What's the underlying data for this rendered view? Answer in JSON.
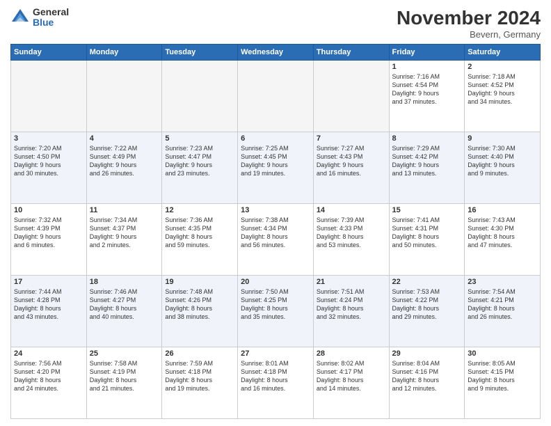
{
  "logo": {
    "general": "General",
    "blue": "Blue"
  },
  "header": {
    "month": "November 2024",
    "location": "Bevern, Germany"
  },
  "weekdays": [
    "Sunday",
    "Monday",
    "Tuesday",
    "Wednesday",
    "Thursday",
    "Friday",
    "Saturday"
  ],
  "weeks": [
    [
      {
        "day": "",
        "info": ""
      },
      {
        "day": "",
        "info": ""
      },
      {
        "day": "",
        "info": ""
      },
      {
        "day": "",
        "info": ""
      },
      {
        "day": "",
        "info": ""
      },
      {
        "day": "1",
        "info": "Sunrise: 7:16 AM\nSunset: 4:54 PM\nDaylight: 9 hours\nand 37 minutes."
      },
      {
        "day": "2",
        "info": "Sunrise: 7:18 AM\nSunset: 4:52 PM\nDaylight: 9 hours\nand 34 minutes."
      }
    ],
    [
      {
        "day": "3",
        "info": "Sunrise: 7:20 AM\nSunset: 4:50 PM\nDaylight: 9 hours\nand 30 minutes."
      },
      {
        "day": "4",
        "info": "Sunrise: 7:22 AM\nSunset: 4:49 PM\nDaylight: 9 hours\nand 26 minutes."
      },
      {
        "day": "5",
        "info": "Sunrise: 7:23 AM\nSunset: 4:47 PM\nDaylight: 9 hours\nand 23 minutes."
      },
      {
        "day": "6",
        "info": "Sunrise: 7:25 AM\nSunset: 4:45 PM\nDaylight: 9 hours\nand 19 minutes."
      },
      {
        "day": "7",
        "info": "Sunrise: 7:27 AM\nSunset: 4:43 PM\nDaylight: 9 hours\nand 16 minutes."
      },
      {
        "day": "8",
        "info": "Sunrise: 7:29 AM\nSunset: 4:42 PM\nDaylight: 9 hours\nand 13 minutes."
      },
      {
        "day": "9",
        "info": "Sunrise: 7:30 AM\nSunset: 4:40 PM\nDaylight: 9 hours\nand 9 minutes."
      }
    ],
    [
      {
        "day": "10",
        "info": "Sunrise: 7:32 AM\nSunset: 4:39 PM\nDaylight: 9 hours\nand 6 minutes."
      },
      {
        "day": "11",
        "info": "Sunrise: 7:34 AM\nSunset: 4:37 PM\nDaylight: 9 hours\nand 2 minutes."
      },
      {
        "day": "12",
        "info": "Sunrise: 7:36 AM\nSunset: 4:35 PM\nDaylight: 8 hours\nand 59 minutes."
      },
      {
        "day": "13",
        "info": "Sunrise: 7:38 AM\nSunset: 4:34 PM\nDaylight: 8 hours\nand 56 minutes."
      },
      {
        "day": "14",
        "info": "Sunrise: 7:39 AM\nSunset: 4:33 PM\nDaylight: 8 hours\nand 53 minutes."
      },
      {
        "day": "15",
        "info": "Sunrise: 7:41 AM\nSunset: 4:31 PM\nDaylight: 8 hours\nand 50 minutes."
      },
      {
        "day": "16",
        "info": "Sunrise: 7:43 AM\nSunset: 4:30 PM\nDaylight: 8 hours\nand 47 minutes."
      }
    ],
    [
      {
        "day": "17",
        "info": "Sunrise: 7:44 AM\nSunset: 4:28 PM\nDaylight: 8 hours\nand 43 minutes."
      },
      {
        "day": "18",
        "info": "Sunrise: 7:46 AM\nSunset: 4:27 PM\nDaylight: 8 hours\nand 40 minutes."
      },
      {
        "day": "19",
        "info": "Sunrise: 7:48 AM\nSunset: 4:26 PM\nDaylight: 8 hours\nand 38 minutes."
      },
      {
        "day": "20",
        "info": "Sunrise: 7:50 AM\nSunset: 4:25 PM\nDaylight: 8 hours\nand 35 minutes."
      },
      {
        "day": "21",
        "info": "Sunrise: 7:51 AM\nSunset: 4:24 PM\nDaylight: 8 hours\nand 32 minutes."
      },
      {
        "day": "22",
        "info": "Sunrise: 7:53 AM\nSunset: 4:22 PM\nDaylight: 8 hours\nand 29 minutes."
      },
      {
        "day": "23",
        "info": "Sunrise: 7:54 AM\nSunset: 4:21 PM\nDaylight: 8 hours\nand 26 minutes."
      }
    ],
    [
      {
        "day": "24",
        "info": "Sunrise: 7:56 AM\nSunset: 4:20 PM\nDaylight: 8 hours\nand 24 minutes."
      },
      {
        "day": "25",
        "info": "Sunrise: 7:58 AM\nSunset: 4:19 PM\nDaylight: 8 hours\nand 21 minutes."
      },
      {
        "day": "26",
        "info": "Sunrise: 7:59 AM\nSunset: 4:18 PM\nDaylight: 8 hours\nand 19 minutes."
      },
      {
        "day": "27",
        "info": "Sunrise: 8:01 AM\nSunset: 4:18 PM\nDaylight: 8 hours\nand 16 minutes."
      },
      {
        "day": "28",
        "info": "Sunrise: 8:02 AM\nSunset: 4:17 PM\nDaylight: 8 hours\nand 14 minutes."
      },
      {
        "day": "29",
        "info": "Sunrise: 8:04 AM\nSunset: 4:16 PM\nDaylight: 8 hours\nand 12 minutes."
      },
      {
        "day": "30",
        "info": "Sunrise: 8:05 AM\nSunset: 4:15 PM\nDaylight: 8 hours\nand 9 minutes."
      }
    ]
  ]
}
